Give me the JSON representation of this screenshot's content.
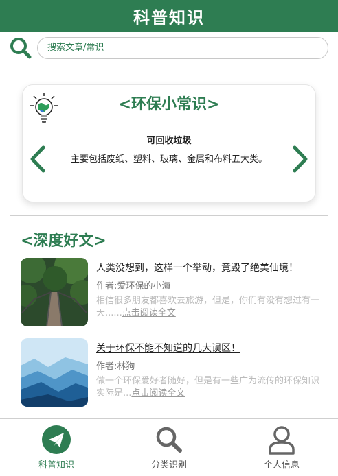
{
  "header": {
    "title": "科普知识"
  },
  "search": {
    "placeholder": "搜索文章/常识"
  },
  "tips": {
    "title": "<环保小常识>",
    "subtitle": "可回收垃圾",
    "text": "主要包括废纸、塑料、玻璃、金属和布料五大类。"
  },
  "articles_section": {
    "title": "<深度好文>"
  },
  "articles": [
    {
      "title": "人类没想到，这样一个举动，竟毁了绝美仙境！",
      "author": "作者:爱环保的小海",
      "excerpt": "相信很多朋友都喜欢去旅游，但是，你们有没有想过有一天......",
      "read_more": "点击阅读全文"
    },
    {
      "title": "关于环保不能不知道的几大误区！",
      "author": "作者:林狗",
      "excerpt": "做一个环保爱好者随好，但是有一些广为流传的环保知识实际是...",
      "read_more": "点击阅读全文"
    }
  ],
  "tabbar": {
    "items": [
      {
        "label": "科普知识",
        "icon": "paper-plane-icon",
        "active": true
      },
      {
        "label": "分类识别",
        "icon": "search-icon",
        "active": false
      },
      {
        "label": "个人信息",
        "icon": "user-icon",
        "active": false
      }
    ]
  },
  "colors": {
    "brand": "#2e7d52"
  }
}
